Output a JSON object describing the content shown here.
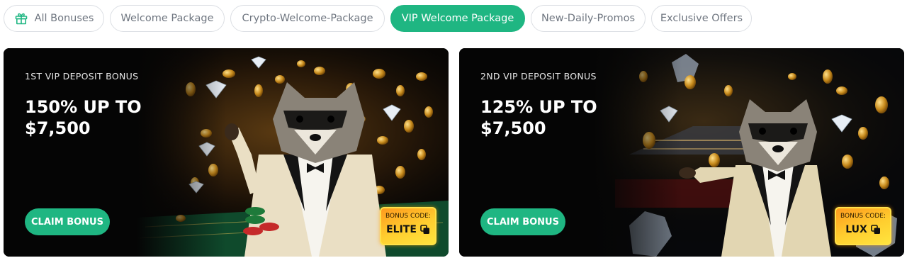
{
  "tabs": [
    {
      "label": "All Bonuses",
      "icon": "gift-icon"
    },
    {
      "label": "Welcome Package"
    },
    {
      "label": "Crypto-Welcome-Package"
    },
    {
      "label": "VIP Welcome Package",
      "active": true
    },
    {
      "label": "New-Daily-Promos"
    },
    {
      "label": "Exclusive Offers"
    }
  ],
  "cards": [
    {
      "subtitle": "1ST VIP DEPOSIT BONUS",
      "title": "150% UP TO $7,500",
      "button_label": "CLAIM BONUS",
      "code_label": "BONUS CODE:",
      "code": "ELITE",
      "copy_icon": "copy-icon"
    },
    {
      "subtitle": "2ND VIP DEPOSIT BONUS",
      "title": "125% UP TO $7,500",
      "button_label": "CLAIM BONUS",
      "code_label": "BONUS CODE:",
      "code": "LUX",
      "copy_icon": "copy-icon"
    }
  ],
  "colors": {
    "accent": "#1fb682",
    "tab_border": "#dcdfe4",
    "tab_text": "#6f7680",
    "card_bg": "#050505",
    "code_gradient_start": "#ff9a1e",
    "code_gradient_end": "#ffe43e"
  }
}
